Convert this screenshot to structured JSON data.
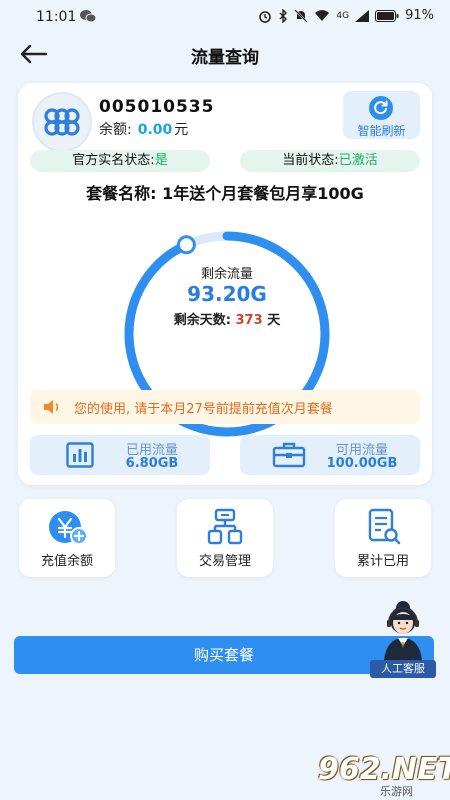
{
  "status_bar": {
    "time": "11:01",
    "battery": "91%",
    "signal_label": "4G"
  },
  "header": {
    "title": "流量查询"
  },
  "account": {
    "phone": "005010535",
    "balance_label": "余额:",
    "balance_value": "0.00",
    "balance_unit": "元",
    "refresh_label": "智能刷新"
  },
  "status_pills": {
    "realname_label": "官方实名状态:",
    "realname_value": "是",
    "current_label": "当前状态:",
    "current_value": "已激活"
  },
  "package": {
    "name": "套餐名称: 1年送个月套餐包月享100G"
  },
  "usage_ring": {
    "remaining_label": "剩余流量",
    "remaining_value": "93.20G",
    "days_label": "剩余天数:",
    "days_value": "373",
    "days_unit": "天",
    "remaining_fraction": 0.932
  },
  "notice": {
    "text": "您的使用, 请于本月27号前提前充值次月套餐"
  },
  "stats": {
    "used": {
      "label": "已用流量",
      "value": "6.80GB"
    },
    "available": {
      "label": "可用流量",
      "value": "100.00GB"
    }
  },
  "actions": [
    {
      "label": "充值余额",
      "icon": "yen-add-icon"
    },
    {
      "label": "交易管理",
      "icon": "transaction-icon"
    },
    {
      "label": "累计已用",
      "icon": "report-search-icon"
    }
  ],
  "support": {
    "label": "人工客服"
  },
  "buy_button": {
    "label": "购买套餐"
  },
  "watermark": {
    "text": "962.NET",
    "sub": "乐游网"
  },
  "colors": {
    "primary": "#2f8ff0",
    "accent_green": "#1bb06a",
    "warning": "#e56a1a",
    "days_red": "#d0462a"
  }
}
